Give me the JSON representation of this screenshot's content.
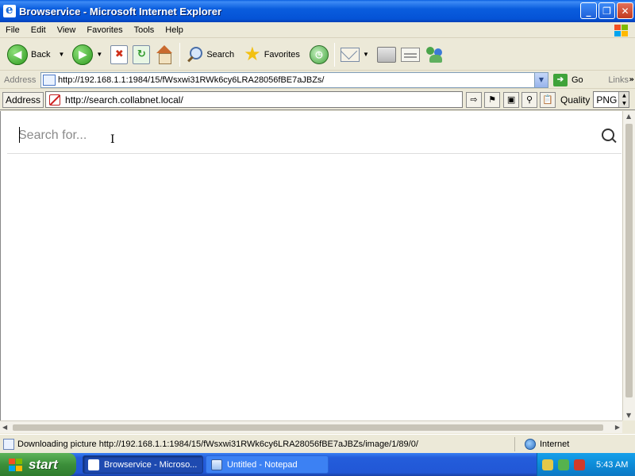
{
  "window": {
    "title": "Browservice - Microsoft Internet Explorer",
    "min": "_",
    "max": "❐",
    "close": "✕"
  },
  "menu": [
    "File",
    "Edit",
    "View",
    "Favorites",
    "Tools",
    "Help"
  ],
  "toolbar": {
    "back": "Back",
    "search": "Search",
    "favorites": "Favorites"
  },
  "address": {
    "label": "Address",
    "url": "http://192.168.1.1:1984/15/fWsxwi31RWk6cy6LRA28056fBE7aJBZs/",
    "go": "Go",
    "links": "Links"
  },
  "browservice": {
    "label": "Address",
    "url": "http://search.collabnet.local/",
    "quality_label": "Quality",
    "quality_value": "PNG"
  },
  "page": {
    "search_placeholder": "Search for..."
  },
  "status": {
    "text": "Downloading picture http://192.168.1.1:1984/15/fWsxwi31RWk6cy6LRA28056fBE7aJBZs/image/1/89/0/",
    "zone": "Internet"
  },
  "taskbar": {
    "start": "start",
    "tasks": [
      "Browservice - Microso...",
      "Untitled - Notepad"
    ],
    "clock": "5:43 AM"
  }
}
